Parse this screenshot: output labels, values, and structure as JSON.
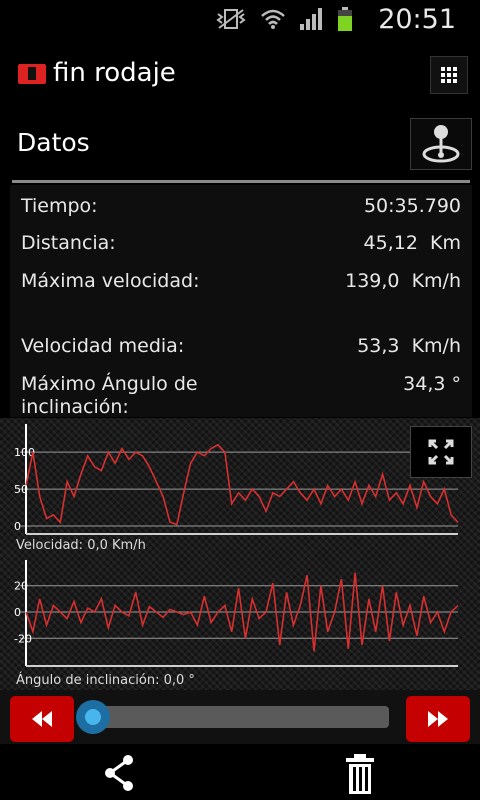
{
  "status_bar": {
    "time": "20:51",
    "battery_color": "#7fd321"
  },
  "action_bar": {
    "title": "fin rodaje",
    "brand_color": "#d22222"
  },
  "panel": {
    "title": "Datos",
    "stats": [
      {
        "label": "Tiempo:",
        "value": "50:35.790"
      },
      {
        "label": "Distancia:",
        "value": "45,12  Km"
      },
      {
        "label": "Máxima velocidad:",
        "value": "139,0  Km/h"
      },
      {
        "label": "Velocidad media:",
        "value": "53,3  Km/h"
      },
      {
        "label": "Máximo Ángulo de inclinación:",
        "value": "34,3 °"
      }
    ]
  },
  "charts": [
    {
      "name": "speed",
      "y_ticks": [
        "100",
        "50",
        "0"
      ],
      "readout": "Velocidad: 0,0  Km/h",
      "line_color": "#d63030"
    },
    {
      "name": "lean",
      "y_ticks": [
        "20",
        "0",
        "-20"
      ],
      "readout": "Ángulo de inclinación: 0,0 °",
      "line_color": "#d63030"
    }
  ],
  "chart_data": [
    {
      "type": "line",
      "ylim": [
        0,
        130
      ],
      "y_ticks": [
        100,
        50,
        0
      ],
      "series": [
        {
          "values": [
            55,
            100,
            40,
            10,
            15,
            5,
            60,
            40,
            70,
            95,
            80,
            75,
            100,
            85,
            105,
            90,
            100,
            95,
            80,
            60,
            40,
            5,
            2,
            45,
            85,
            100,
            95,
            105,
            110,
            100,
            30,
            45,
            35,
            50,
            40,
            20,
            45,
            40,
            50,
            60,
            45,
            35,
            50,
            30,
            55,
            40,
            50,
            35,
            60,
            30,
            55,
            40,
            70,
            35,
            45,
            30,
            55,
            25,
            60,
            40,
            30,
            50,
            15,
            5
          ]
        }
      ]
    },
    {
      "type": "line",
      "ylim": [
        -35,
        35
      ],
      "y_ticks": [
        20,
        0,
        -20
      ],
      "series": [
        {
          "values": [
            0,
            -15,
            10,
            -10,
            5,
            0,
            -5,
            8,
            -8,
            3,
            0,
            10,
            -12,
            5,
            0,
            -3,
            15,
            -10,
            4,
            0,
            -4,
            2,
            0,
            -2,
            0,
            -10,
            12,
            -8,
            0,
            5,
            -15,
            18,
            -20,
            10,
            -5,
            0,
            22,
            -25,
            15,
            -10,
            5,
            28,
            -30,
            20,
            -15,
            0,
            25,
            -28,
            30,
            -25,
            10,
            -15,
            20,
            -22,
            15,
            -10,
            5,
            -18,
            12,
            -8,
            0,
            -15,
            0,
            5
          ]
        }
      ]
    }
  ],
  "player": {
    "progress_percent": 3
  }
}
